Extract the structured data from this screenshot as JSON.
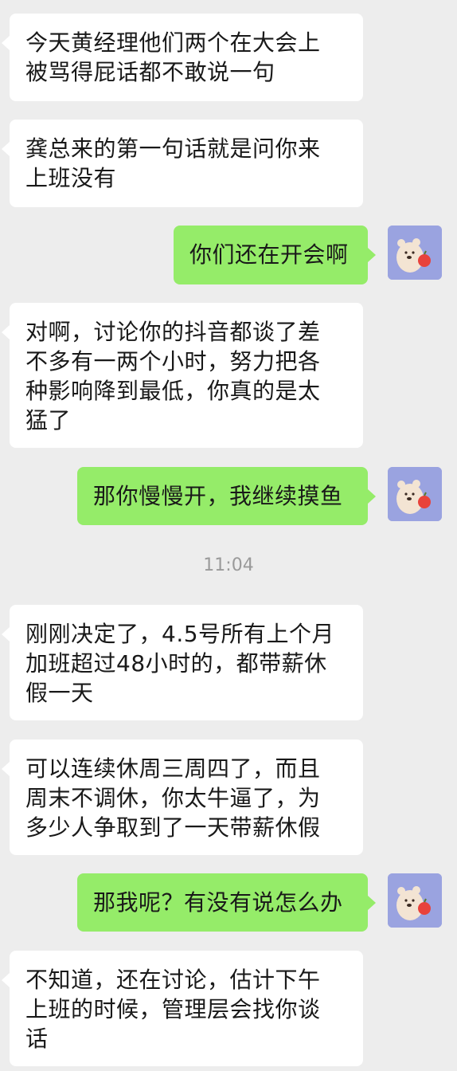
{
  "chat": {
    "messages": [
      {
        "side": "left",
        "text": "今天黄经理他们两个在大会上\n被骂得屁话都不敢说一句"
      },
      {
        "side": "left",
        "text": "龚总来的第一句话就是问你来\n上班没有"
      },
      {
        "side": "right",
        "text": "你们还在开会啊"
      },
      {
        "side": "left",
        "text": "对啊，讨论你的抖音都谈了差\n不多有一两个小时，努力把各\n种影响降到最低，你真的是太\n猛了"
      },
      {
        "side": "right",
        "text": "那你慢慢开，我继续摸鱼"
      },
      {
        "side": "left",
        "text": "刚刚决定了，4.5号所有上个月\n加班超过48小时的，都带薪休\n假一天"
      },
      {
        "side": "left",
        "text": "可以连续休周三周四了，而且\n周末不调休，你太牛逼了，为\n多少人争取到了一天带薪休假"
      },
      {
        "side": "right",
        "text": "那我呢？有没有说怎么办"
      },
      {
        "side": "left",
        "text": "不知道，还在讨论，估计下午\n上班的时候，管理层会找你谈\n话"
      }
    ],
    "timestamp": "11:04",
    "avatar_icon": "bear-with-apple-avatar",
    "colors": {
      "background": "#ededed",
      "incoming_bubble": "#ffffff",
      "outgoing_bubble": "#95ec69",
      "avatar_bg": "#9aa3e0"
    }
  }
}
